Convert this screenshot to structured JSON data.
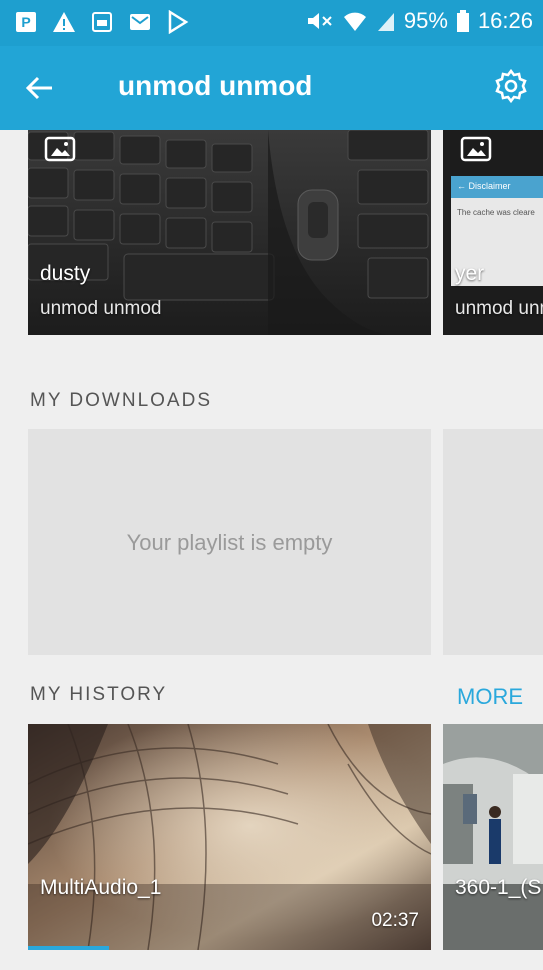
{
  "status_bar": {
    "battery": "95%",
    "time": "16:26",
    "left_icons": [
      "app-p-icon",
      "warning-icon",
      "gallery-icon",
      "mail-icon",
      "play-store-icon"
    ]
  },
  "app_bar": {
    "title": "unmod unmod",
    "back_icon": "arrow-left-icon",
    "settings_icon": "gear-icon"
  },
  "top_cards": [
    {
      "title": "dusty",
      "subtitle": "unmod unmod",
      "type_icon": "image-icon"
    },
    {
      "title": "yer",
      "subtitle": "unmod unmod",
      "type_icon": "image-icon",
      "thumb_header": "Disclaimer",
      "thumb_text": "The cache was cleare"
    }
  ],
  "downloads": {
    "heading": "MY DOWNLOADS",
    "empty_message": "Your playlist is empty"
  },
  "history": {
    "heading": "MY HISTORY",
    "more_label": "MORE",
    "items": [
      {
        "title": "MultiAudio_1",
        "duration": "02:37",
        "progress": 0.2
      },
      {
        "title": "360-1_(S",
        "duration": "",
        "progress": 0
      }
    ]
  },
  "colors": {
    "status_bar": "#1e9fcf",
    "app_bar": "#22a5d6",
    "accent": "#2aa8dc",
    "background": "#efefef"
  }
}
